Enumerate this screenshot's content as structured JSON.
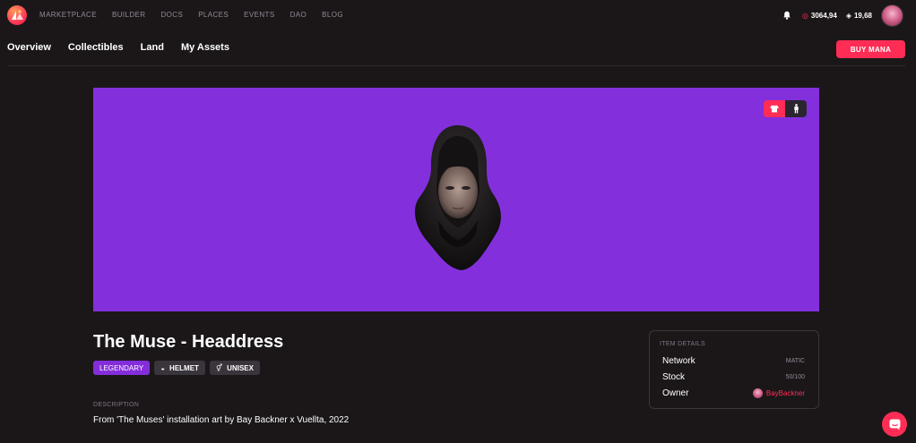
{
  "topnav": {
    "links": [
      "MARKETPLACE",
      "BUILDER",
      "DOCS",
      "PLACES",
      "EVENTS",
      "DAO",
      "BLOG"
    ],
    "mana_balance": "3064,94",
    "matic_balance": "19,68"
  },
  "subnav": {
    "tabs": [
      "Overview",
      "Collectibles",
      "Land",
      "My Assets"
    ],
    "buy_button": "BUY MANA"
  },
  "item": {
    "title": "The Muse - Headdress",
    "rarity": "LEGENDARY",
    "category": "HELMET",
    "gender": "UNISEX",
    "description_label": "DESCRIPTION",
    "description": "From 'The Muses' installation art by Bay Backner x Vuellta, 2022",
    "background_color": "#8330dc"
  },
  "details": {
    "header": "ITEM DETAILS",
    "network_label": "Network",
    "network_value": "MATIC",
    "stock_label": "Stock",
    "stock_value": "50/100",
    "owner_label": "Owner",
    "owner_value": "BayBackner"
  },
  "colors": {
    "accent": "#ff2d55",
    "rarity_legendary": "#842ddb",
    "background": "#1b1719"
  }
}
